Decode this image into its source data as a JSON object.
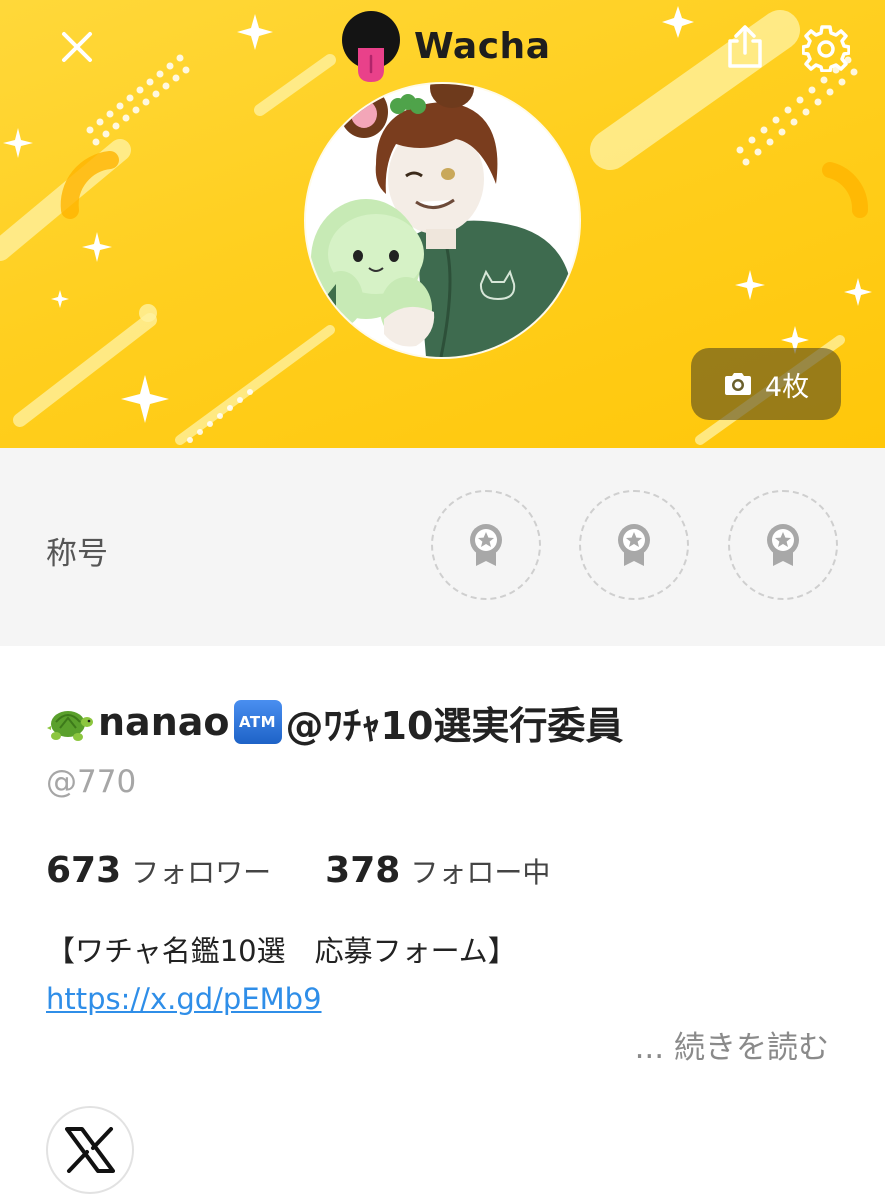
{
  "header": {
    "brand_name": "Wacha",
    "icons": {
      "close": "close-icon",
      "logo": "wacha-logo",
      "share": "share-icon",
      "settings": "gear-icon",
      "camera": "camera-icon"
    },
    "photo_count_label": "4枚"
  },
  "titles": {
    "label": "称号",
    "badges": [
      "award-badge-empty",
      "award-badge-empty",
      "award-badge-empty"
    ]
  },
  "profile": {
    "name_prefix_emoji": "turtle",
    "name_part1": "nanao",
    "atm_label": "ATM",
    "name_part2": "@ﾜﾁｬ10選実行委員",
    "username": "@770",
    "followers_count": "673",
    "followers_label": "フォロワー",
    "following_count": "378",
    "following_label": "フォロー中",
    "bio_line": "【ワチャ名鑑10選　応募フォーム】",
    "bio_link": "https://x.gd/pEMb9",
    "read_more": "... 続きを読む",
    "social_icon": "x-logo-icon"
  },
  "colors": {
    "banner_yellow": "#ffcf1f",
    "brand_text": "#1e1e1e",
    "link_blue": "#2f8ee8",
    "muted_gray": "#a6a6a6",
    "section_bg": "#f5f5f5"
  }
}
